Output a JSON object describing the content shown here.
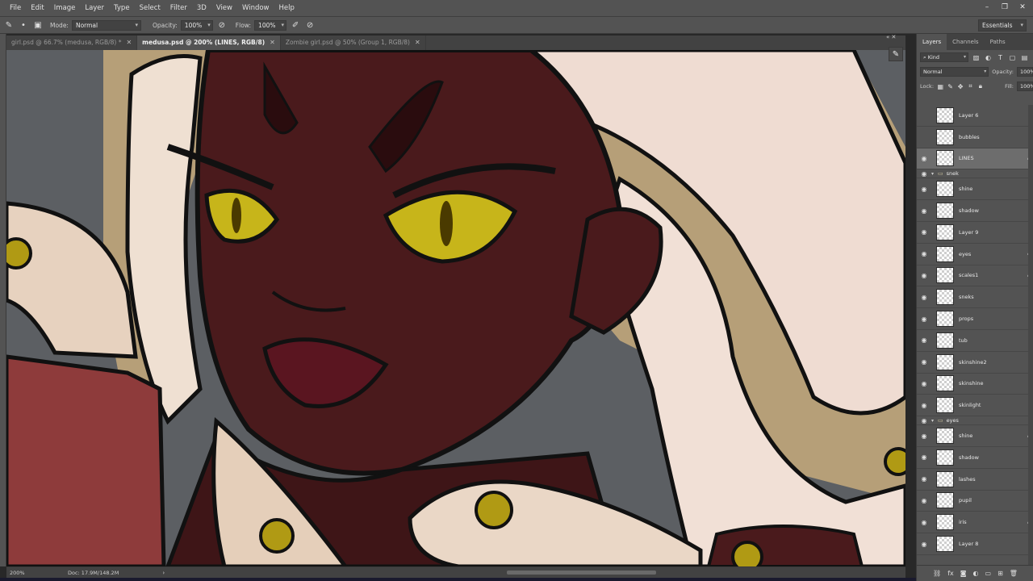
{
  "menubar": {
    "items": [
      "File",
      "Edit",
      "Image",
      "Layer",
      "Type",
      "Select",
      "Filter",
      "3D",
      "View",
      "Window",
      "Help"
    ],
    "window_controls": [
      "minimize-icon",
      "restore-icon",
      "close-icon"
    ]
  },
  "options": {
    "mode_label": "Mode:",
    "mode_value": "Normal",
    "opacity_label": "Opacity:",
    "opacity_value": "100%",
    "flow_label": "Flow:",
    "flow_value": "100%",
    "workspace": "Essentials"
  },
  "tabs": [
    {
      "label": "girl.psd @ 66.7% (medusa, RGB/8) *",
      "active": false
    },
    {
      "label": "medusa.psd @ 200% (LINES, RGB/8)",
      "active": true
    },
    {
      "label": "Zombie girl.psd @ 50% (Group 1, RGB/8)",
      "active": false
    }
  ],
  "status": {
    "zoom": "200%",
    "doc": "Doc: 17.9M/148.2M"
  },
  "panel": {
    "tabs": [
      "Layers",
      "Channels",
      "Paths"
    ],
    "kind_label": "Kind",
    "blend_mode": "Normal",
    "opacity_label": "Opacity:",
    "opacity_value": "100%",
    "lock_label": "Lock:",
    "fill_label": "Fill:",
    "fill_value": "100%"
  },
  "layers": [
    {
      "name": "Layer 6",
      "visible": false,
      "locked": false,
      "group": false
    },
    {
      "name": "bubbles",
      "visible": false,
      "locked": false,
      "group": false
    },
    {
      "name": "LINES",
      "visible": true,
      "locked": true,
      "group": false,
      "active": true
    },
    {
      "name": "snek",
      "visible": true,
      "locked": false,
      "group": true
    },
    {
      "name": "shine",
      "visible": true,
      "locked": false,
      "group": false
    },
    {
      "name": "shadow",
      "visible": true,
      "locked": false,
      "group": false
    },
    {
      "name": "Layer 9",
      "visible": true,
      "locked": false,
      "group": false
    },
    {
      "name": "eyes",
      "visible": true,
      "locked": true,
      "group": false
    },
    {
      "name": "scales1",
      "visible": true,
      "locked": true,
      "group": false
    },
    {
      "name": "sneks",
      "visible": true,
      "locked": false,
      "group": false
    },
    {
      "name": "props",
      "visible": true,
      "locked": false,
      "group": false
    },
    {
      "name": "tub",
      "visible": true,
      "locked": false,
      "group": false
    },
    {
      "name": "skinshine2",
      "visible": true,
      "locked": false,
      "group": false
    },
    {
      "name": "skinshine",
      "visible": true,
      "locked": false,
      "group": false
    },
    {
      "name": "skinlight",
      "visible": true,
      "locked": false,
      "group": false
    },
    {
      "name": "eyes",
      "visible": true,
      "locked": false,
      "group": true
    },
    {
      "name": "shine",
      "visible": true,
      "locked": true,
      "group": false
    },
    {
      "name": "shadow",
      "visible": true,
      "locked": false,
      "group": false
    },
    {
      "name": "lashes",
      "visible": true,
      "locked": false,
      "group": false
    },
    {
      "name": "pupil",
      "visible": true,
      "locked": false,
      "group": false
    },
    {
      "name": "iris",
      "visible": true,
      "locked": true,
      "group": false
    },
    {
      "name": "Layer 8",
      "visible": true,
      "locked": false,
      "group": false
    }
  ]
}
